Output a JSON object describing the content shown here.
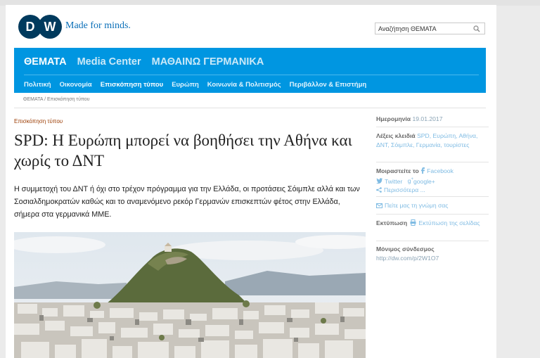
{
  "header": {
    "logo_text": "DW",
    "tagline": "Made for minds.",
    "search_placeholder": "Αναζήτηση ΘΕΜΑΤΑ"
  },
  "nav": {
    "main": [
      "ΘΕΜΑΤΑ",
      "Media Center",
      "ΜΑΘΑΙΝΩ ΓΕΡΜΑΝΙΚΑ"
    ],
    "sub": [
      "Πολιτική",
      "Οικονομία",
      "Επισκόπηση τύπου",
      "Ευρώπη",
      "Κοινωνία & Πολιτισμός",
      "Περιβάλλον & Επιστήμη"
    ],
    "active_sub": "Επισκόπηση τύπου"
  },
  "breadcrumb": "ΘΕΜΑΤΑ / Επισκόπηση τύπου",
  "article": {
    "kicker": "Επισκόπηση τύπου",
    "headline": "SPD: Η Ευρώπη μπορεί να βοηθήσει την Αθήνα και χωρίς το ΔΝΤ",
    "lead": "Η συμμετοχή του ΔΝΤ ή όχι στο τρέχον πρόγραμμα για την Ελλάδα, οι προτάσεις Σόιμπλε αλλά και των Σοσιαλδημοκρατών καθώς και το αναμενόμενο ρεκόρ Γερμανών επισκεπτών φέτος στην Ελλάδα, σήμερα στα γερμανικά ΜΜΕ."
  },
  "sidebar": {
    "date_label": "Ημερομηνία",
    "date_value": "19.01.2017",
    "keywords_label": "Λέξεις κλειδιά",
    "keywords_value": "SPD, Ευρώπη, Αθήνα, ΔΝΤ, Σόιμπλε, Γερμανία, τουρίστες",
    "share_label": "Μοιραστείτε το",
    "share_facebook": "Facebook",
    "share_twitter": "Twitter",
    "share_google": "google+",
    "share_more": "Περισσότερα ...",
    "feedback": "Πείτε μας τη γνώμη σας",
    "print_label": "Εκτύπωση",
    "print_value": "Εκτύπωση της σελίδας",
    "permalink_label": "Μόνιμος σύνδεσμος",
    "permalink_value": "http://dw.com/p/2W1O7"
  },
  "colors": {
    "nav_blue": "#0096e1",
    "logo_navy": "#003a5d",
    "kicker": "#9a3a00",
    "link": "#7fbbe3"
  }
}
